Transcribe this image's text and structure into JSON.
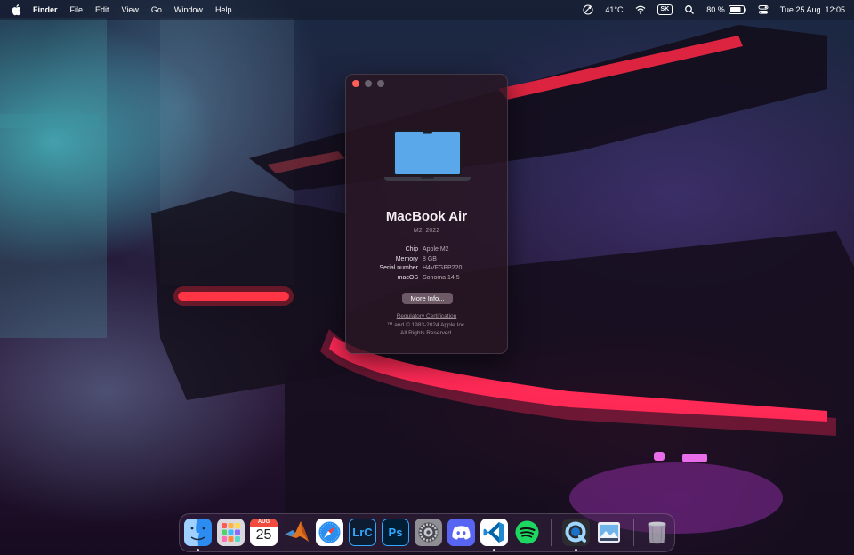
{
  "menubar": {
    "app_name": "Finder",
    "menus": [
      "File",
      "Edit",
      "View",
      "Go",
      "Window",
      "Help"
    ],
    "temperature": "41°C",
    "keyboard_layout": "SK",
    "battery": "80 %",
    "datetime": "Tue 25 Aug  12:05"
  },
  "about": {
    "model": "MacBook Air",
    "subtitle": "M2, 2022",
    "specs": [
      {
        "key": "Chip",
        "value": "Apple M2"
      },
      {
        "key": "Memory",
        "value": "8 GB"
      },
      {
        "key": "Serial number",
        "value": "H4VFGPP220"
      },
      {
        "key": "macOS",
        "value": "Sonoma 14.5"
      }
    ],
    "more_info_label": "More Info...",
    "regulatory_link": "Regulatory Certification",
    "copyright_line1": "™ and © 1983-2024 Apple Inc.",
    "copyright_line2": "All Rights Reserved."
  },
  "dock": {
    "calendar_month": "AUG",
    "calendar_day": "25",
    "lightroom_label": "LrC",
    "photoshop_label": "Ps",
    "apps": [
      "finder-icon",
      "launchpad-icon",
      "calendar-icon",
      "matlab-icon",
      "safari-icon",
      "lightroom-classic-icon",
      "photoshop-icon",
      "system-settings-icon",
      "discord-icon",
      "vscode-icon",
      "spotify-icon",
      "quicktime-icon",
      "preview-icon",
      "trash-icon"
    ]
  },
  "colors": {
    "close_button": "#ff5f57",
    "accent_red": "#ff2a55",
    "spotify_green": "#1ed760",
    "discord_blurple": "#5865f2"
  }
}
